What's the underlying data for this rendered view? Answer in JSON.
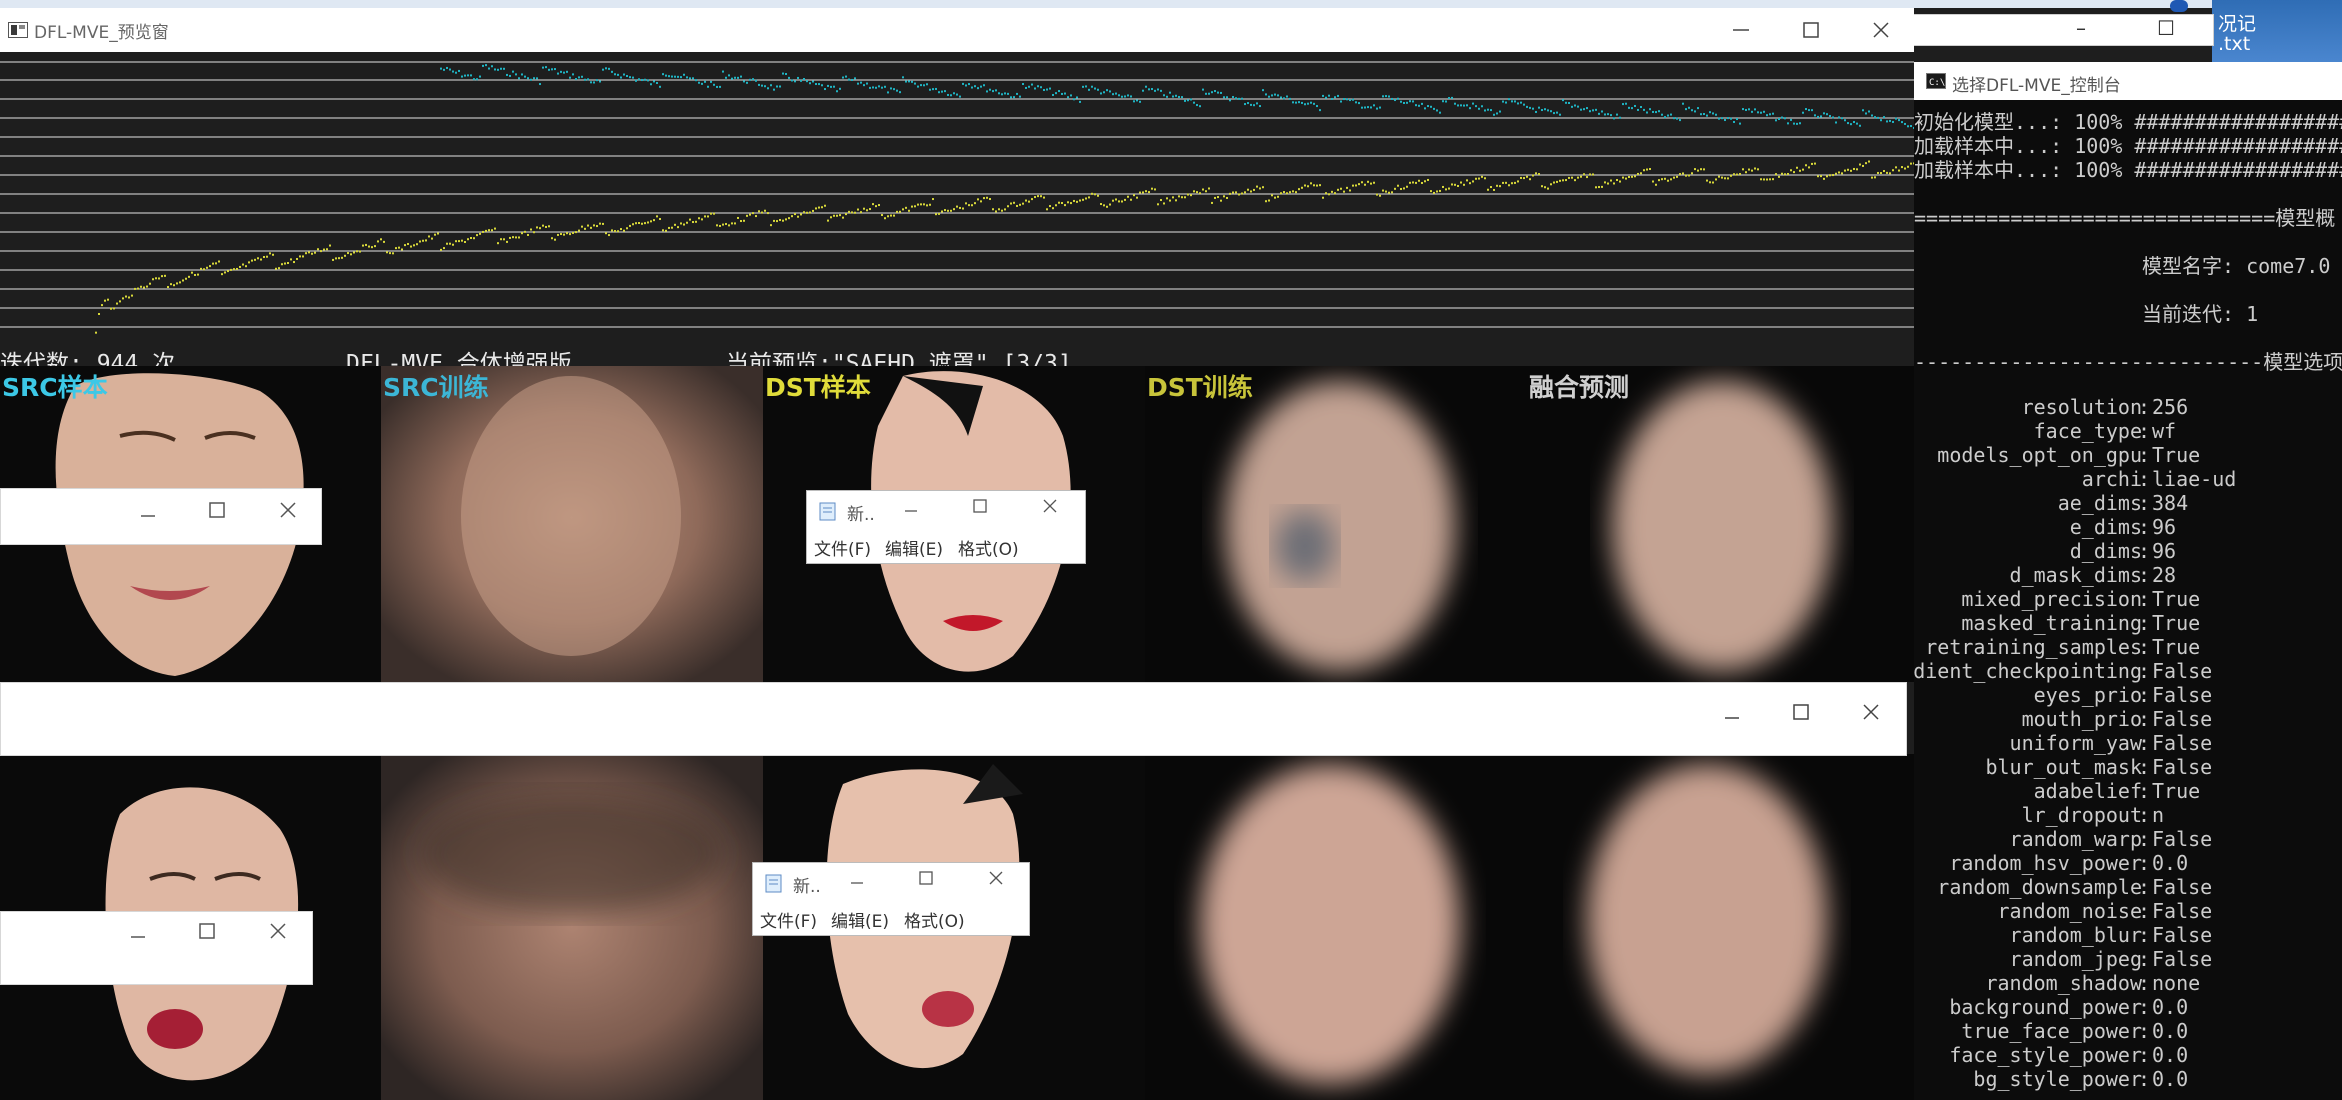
{
  "preview_window": {
    "title": "DFL-MVE_预览窗",
    "status": {
      "iterations": "迭代数: 944 次",
      "product": "DFL-MVE_合体增强版",
      "current_preview": "当前预览:\"SAEHD 遮罩\" [3/3]"
    },
    "columns": [
      {
        "label": "SRC样本",
        "color": "#3cc8e6"
      },
      {
        "label": "SRC训练",
        "color": "#3cb6d6"
      },
      {
        "label": "DST样本",
        "color": "#e0dc3a"
      },
      {
        "label": "DST训练",
        "color": "#c8c43a"
      },
      {
        "label": "融合预测",
        "color": "#d0d0d0"
      }
    ],
    "loss_colors": {
      "src": "#1fb5c4",
      "dst": "#d8d83a"
    }
  },
  "mini_notepad": {
    "title": "新..",
    "menus": [
      "文件(F)",
      "编辑(E)",
      "格式(O)"
    ]
  },
  "console": {
    "title": "选择DFL-MVE_控制台",
    "progress": [
      "初始化模型...: 100% ###################",
      "加载样本中...: 100% ###################",
      "加载样本中...: 100% ###################"
    ],
    "section_model_summary": "==============================模型概",
    "model_name_line": "模型名字: come7.0",
    "iteration_line": "当前迭代: 1",
    "section_options": "-----------------------------模型选项",
    "params": [
      {
        "key": "resolution",
        "value": "256"
      },
      {
        "key": "face_type",
        "value": "wf"
      },
      {
        "key": "models_opt_on_gpu",
        "value": "True"
      },
      {
        "key": "archi",
        "value": "liae-ud"
      },
      {
        "key": "ae_dims",
        "value": "384"
      },
      {
        "key": "e_dims",
        "value": "96"
      },
      {
        "key": "d_dims",
        "value": "96"
      },
      {
        "key": "d_mask_dims",
        "value": "28"
      },
      {
        "key": "mixed_precision",
        "value": "True"
      },
      {
        "key": "masked_training",
        "value": "True"
      },
      {
        "key": "retraining_samples",
        "value": "True"
      },
      {
        "key": "gradient_checkpointing",
        "value": "False"
      },
      {
        "key": "eyes_prio",
        "value": "False"
      },
      {
        "key": "mouth_prio",
        "value": "False"
      },
      {
        "key": "uniform_yaw",
        "value": "False"
      },
      {
        "key": "blur_out_mask",
        "value": "False"
      },
      {
        "key": "adabelief",
        "value": "True"
      },
      {
        "key": "lr_dropout",
        "value": "n"
      },
      {
        "key": "random_warp",
        "value": "False"
      },
      {
        "key": "random_hsv_power",
        "value": "0.0"
      },
      {
        "key": "random_downsample",
        "value": "False"
      },
      {
        "key": "random_noise",
        "value": "False"
      },
      {
        "key": "random_blur",
        "value": "False"
      },
      {
        "key": "random_jpeg",
        "value": "False"
      },
      {
        "key": "random_shadow",
        "value": "none"
      },
      {
        "key": "background_power",
        "value": "0.0"
      },
      {
        "key": "true_face_power",
        "value": "0.0"
      },
      {
        "key": "face_style_power",
        "value": "0.0"
      },
      {
        "key": "bg_style_power",
        "value": "0.0"
      }
    ]
  },
  "desktop": {
    "file_label": "况记\n.txt"
  }
}
